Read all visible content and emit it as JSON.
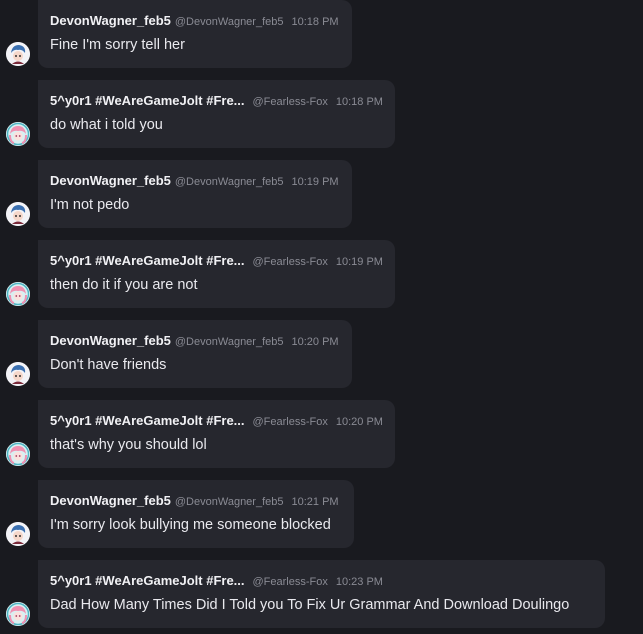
{
  "users": {
    "devon": {
      "name": "DevonWagner_feb5",
      "handle": "@DevonWagner_feb5",
      "avatar_icon": "anime-avatar-blue-hair-icon"
    },
    "fox": {
      "name": "5^y0r1 #WeAreGameJolt #Fre...",
      "handle": "@Fearless-Fox",
      "avatar_icon": "anime-avatar-pink-hair-icon"
    }
  },
  "messages": [
    {
      "user": "devon",
      "time": "10:18 PM",
      "text": "Fine I'm sorry tell her"
    },
    {
      "user": "fox",
      "time": "10:18 PM",
      "text": "do what i told you"
    },
    {
      "user": "devon",
      "time": "10:19 PM",
      "text": "I'm not pedo"
    },
    {
      "user": "fox",
      "time": "10:19 PM",
      "text": "then do it if you are not"
    },
    {
      "user": "devon",
      "time": "10:20 PM",
      "text": "Don't have friends"
    },
    {
      "user": "fox",
      "time": "10:20 PM",
      "text": "that's why you should lol"
    },
    {
      "user": "devon",
      "time": "10:21 PM",
      "text": "I'm sorry look bullying me someone blocked"
    },
    {
      "user": "fox",
      "time": "10:23 PM",
      "text": "Dad How Many Times Did I Told you To Fix Ur Grammar And Download Doulingo"
    }
  ]
}
